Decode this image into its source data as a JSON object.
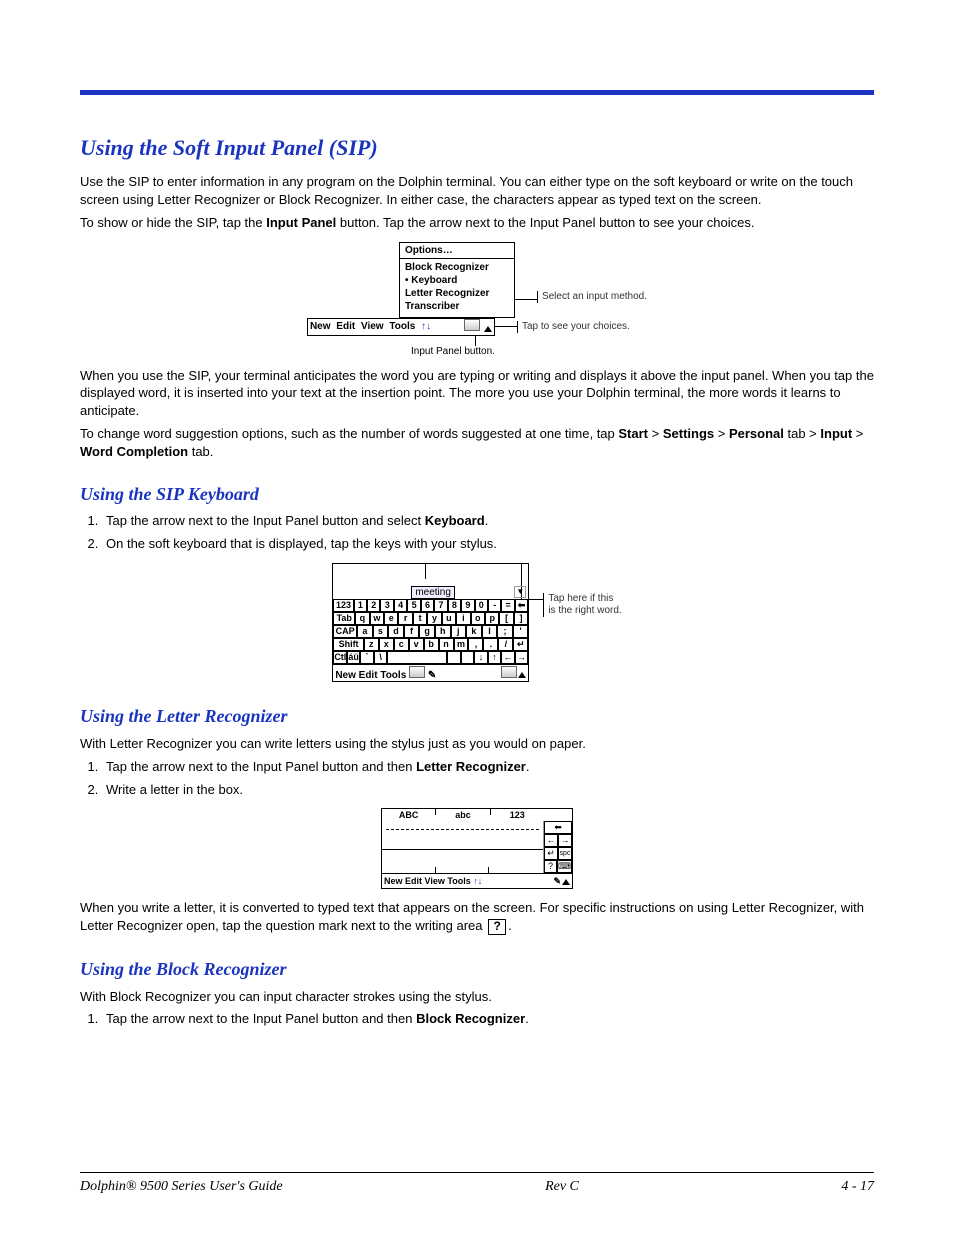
{
  "h_main": "Using the Soft Input Panel (SIP)",
  "p1": "Use the SIP to enter information in any program on the Dolphin terminal. You can either type on the soft keyboard or write on the touch screen using Letter Recognizer or Block Recognizer. In either case, the characters appear as typed text on the screen.",
  "p2a": "To show or hide the SIP, tap the ",
  "p2b": "Input Panel",
  "p2c": " button. Tap the arrow next to the Input Panel button to see your choices.",
  "fig1": {
    "options": "Options…",
    "items": [
      "Block Recognizer",
      "Keyboard",
      "Letter Recognizer",
      "Transcriber"
    ],
    "toolbar": [
      "New",
      "Edit",
      "View",
      "Tools"
    ],
    "c1": "Select an input method.",
    "c2": "Tap to see your choices.",
    "c3": "Input Panel button."
  },
  "p3": "When you use the SIP, your terminal anticipates the word you are typing or writing and displays it above the input panel. When you tap the displayed word, it is inserted into your text at the insertion point. The more you use your Dolphin terminal, the more words it learns to anticipate.",
  "p4": {
    "a": "To change word suggestion options, such as the number of words suggested at one time, tap ",
    "b": "Start",
    "c": " > ",
    "d": "Settings",
    "e": " > ",
    "f": "Personal",
    "g": " tab > ",
    "h": "Input",
    "i": " > ",
    "j": "Word Completion",
    "k": " tab."
  },
  "h_kb": "Using the SIP Keyboard",
  "kb_li1a": "Tap the arrow next to the Input Panel button and select ",
  "kb_li1b": "Keyboard",
  "kb_li1c": ".",
  "kb_li2": "On the soft keyboard that is displayed, tap the keys with your stylus.",
  "fig2": {
    "suggest": "meeting",
    "row1": [
      "123",
      "1",
      "2",
      "3",
      "4",
      "5",
      "6",
      "7",
      "8",
      "9",
      "0",
      "-",
      "=",
      "⬅"
    ],
    "row2": [
      "Tab",
      "q",
      "w",
      "e",
      "r",
      "t",
      "y",
      "u",
      "i",
      "o",
      "p",
      "[",
      "]"
    ],
    "row3": [
      "CAP",
      "a",
      "s",
      "d",
      "f",
      "g",
      "h",
      "j",
      "k",
      "l",
      ";",
      "'"
    ],
    "row4": [
      "Shift",
      "z",
      "x",
      "c",
      "v",
      "b",
      "n",
      "m",
      ",",
      ".",
      "/",
      "↵"
    ],
    "row5": [
      "Ctl",
      "áü",
      "`",
      "\\",
      "",
      "",
      "",
      "↓",
      "↑",
      "←",
      "→"
    ],
    "bar": [
      "New",
      "Edit",
      "Tools"
    ],
    "call1": "Tap here if this",
    "call2": "is the right word."
  },
  "h_lr": "Using the Letter Recognizer",
  "lr_p": "With Letter Recognizer you can write letters using the stylus just as you would on paper.",
  "lr_li1a": "Tap the arrow next to the Input Panel button and then ",
  "lr_li1b": "Letter Recognizer",
  "lr_li1c": ".",
  "lr_li2": "Write a letter in the box.",
  "fig3": {
    "segs": [
      "ABC",
      "abc",
      "123"
    ],
    "side": [
      "⬅",
      "←",
      "→",
      "↵",
      "spc",
      "?",
      "⌨"
    ],
    "bar": [
      "New",
      "Edit",
      "View",
      "Tools"
    ]
  },
  "p5a": "When you write a letter, it is converted to typed text that appears on the screen. For specific instructions on using Letter Recognizer, with Letter Recognizer open, tap the question mark next to the writing area ",
  "p5b": ".",
  "h_br": "Using the Block Recognizer",
  "br_p": "With Block Recognizer you can input character strokes using the stylus.",
  "br_li1a": "Tap the arrow next to the Input Panel button and then ",
  "br_li1b": "Block Recognizer",
  "br_li1c": ".",
  "footer": {
    "left": "Dolphin® 9500 Series User's Guide",
    "mid": "Rev C",
    "right": "4 - 17"
  }
}
